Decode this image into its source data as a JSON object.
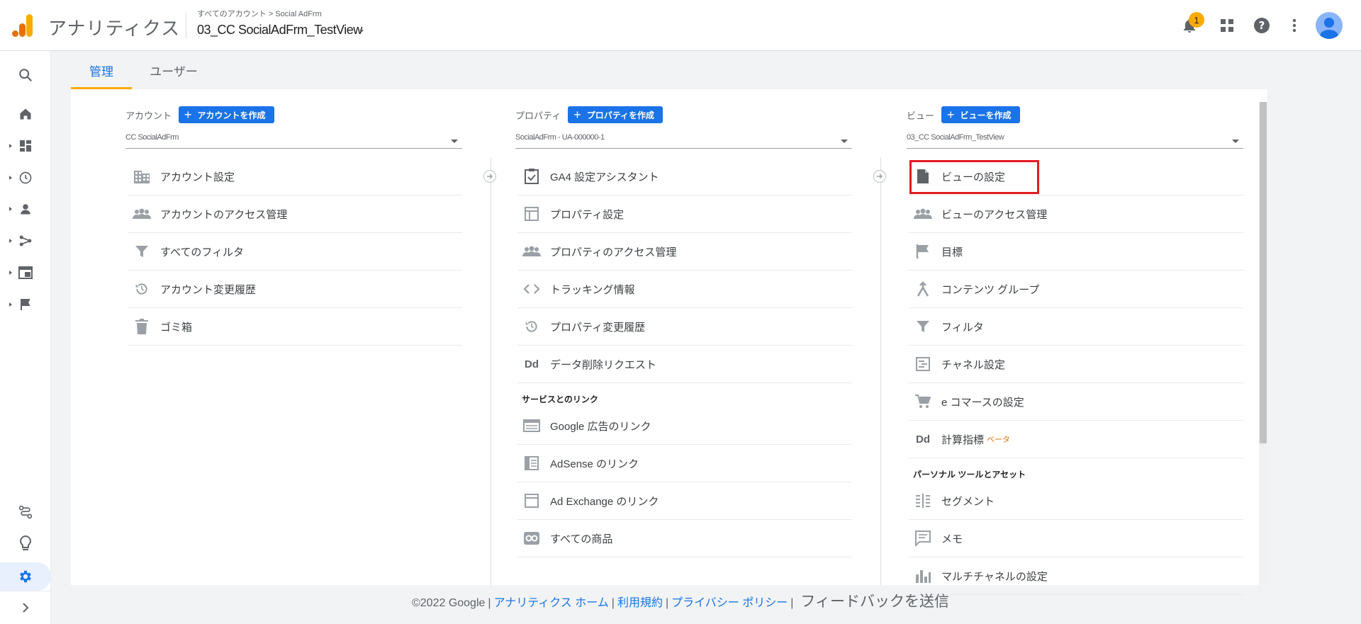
{
  "header": {
    "app_title": "アナリティクス",
    "account_path": "すべてのアカウント > Social AdFrm",
    "view_name": "03_CC SocialAdFrm_TestView",
    "notification_count": "1"
  },
  "tabs": [
    {
      "label": "管理"
    },
    {
      "label": "ユーザー"
    }
  ],
  "account": {
    "label": "アカウント",
    "create": "アカウントを作成",
    "selector_value": "CC SocialAdFrm",
    "items": [
      {
        "label": "アカウント設定",
        "icon": "building-icon"
      },
      {
        "label": "アカウントのアクセス管理",
        "icon": "people-icon"
      },
      {
        "label": "すべてのフィルタ",
        "icon": "filter-icon"
      },
      {
        "label": "アカウント変更履歴",
        "icon": "history-icon"
      },
      {
        "label": "ゴミ箱",
        "icon": "trash-icon"
      }
    ]
  },
  "property": {
    "label": "プロパティ",
    "create": "プロパティを作成",
    "selector_value": "SocialAdFrm - UA-000000-1",
    "items": [
      {
        "label": "GA4 設定アシスタント",
        "icon": "checklist-icon"
      },
      {
        "label": "プロパティ設定",
        "icon": "layout-icon"
      },
      {
        "label": "プロパティのアクセス管理",
        "icon": "people-icon"
      },
      {
        "label": "トラッキング情報",
        "icon": "code-icon"
      },
      {
        "label": "プロパティ変更履歴",
        "icon": "history-icon"
      },
      {
        "label": "データ削除リクエスト",
        "icon": "dd-icon"
      }
    ],
    "links_section": "サービスとのリンク",
    "links": [
      {
        "label": "Google 広告のリンク",
        "icon": "ads-icon"
      },
      {
        "label": "AdSense のリンク",
        "icon": "adsense-icon"
      },
      {
        "label": "Ad Exchange のリンク",
        "icon": "adexchange-icon"
      },
      {
        "label": "すべての商品",
        "icon": "link-icon"
      }
    ]
  },
  "view": {
    "label": "ビュー",
    "create": "ビューを作成",
    "selector_value": "03_CC SocialAdFrm_TestView",
    "items": [
      {
        "label": "ビューの設定",
        "icon": "document-icon"
      },
      {
        "label": "ビューのアクセス管理",
        "icon": "people-icon"
      },
      {
        "label": "目標",
        "icon": "flag-icon"
      },
      {
        "label": "コンテンツ グループ",
        "icon": "content-group-icon"
      },
      {
        "label": "フィルタ",
        "icon": "filter-icon"
      },
      {
        "label": "チャネル設定",
        "icon": "channel-icon"
      },
      {
        "label": "e コマースの設定",
        "icon": "cart-icon"
      },
      {
        "label": "計算指標",
        "icon": "dd-icon",
        "badge": "ベータ"
      }
    ],
    "tools_section": "パーソナル ツールとアセット",
    "tools": [
      {
        "label": "セグメント",
        "icon": "segment-icon"
      },
      {
        "label": "メモ",
        "icon": "note-icon"
      },
      {
        "label": "マルチチャネルの設定",
        "icon": "bar-chart-icon"
      }
    ]
  },
  "footer": {
    "copyright": "©2022 Google",
    "home": "アナリティクス ホーム",
    "terms": "利用規約",
    "privacy": "プライバシー ポリシー",
    "feedback": "フィードバックを送信"
  },
  "colors": {
    "accent": "#1a73e8",
    "tab_indicator": "#f9ab00",
    "highlight": "#e11b22"
  }
}
